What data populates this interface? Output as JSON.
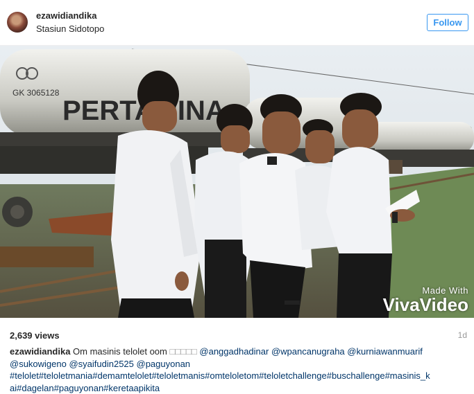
{
  "post": {
    "username": "ezawidiandika",
    "location": "Stasiun Sidotopo",
    "follow_label": "Follow",
    "views": "2,639 views",
    "time": "1d"
  },
  "media": {
    "train_text": "PERTAMINA",
    "car_number": "GK 3065128",
    "watermark_line1": "Made With",
    "watermark_line2": "VivaVideo"
  },
  "caption": {
    "username": "ezawidiandika",
    "text": "Om masinis telolet oom",
    "emoji": "□□□□□",
    "mentions_line1": "@anggadhadinar @wpancanugraha @kurniawanmuarif",
    "mentions_line2": "@sukowigeno @syaifudin2525 @paguyonan",
    "hashtags_line1": "#telolet#teloletmania#demamtelolet#teloletmanis#omteloletom#teloletchallenge#buschallenge#masinis_k",
    "hashtags_line2": "ai#dagelan#paguyonan#keretaapikita"
  },
  "colors": {
    "link": "#003569",
    "follow_blue": "#3897f0",
    "text": "#262626",
    "muted": "#999999"
  }
}
